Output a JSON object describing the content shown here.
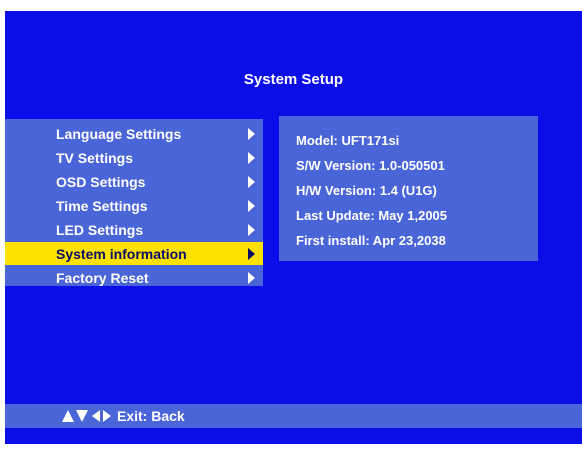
{
  "header": {
    "title": "System Setup"
  },
  "menu": {
    "items": [
      {
        "label": "Language Settings"
      },
      {
        "label": "TV Settings"
      },
      {
        "label": "OSD Settings"
      },
      {
        "label": "Time Settings"
      },
      {
        "label": "LED Settings"
      },
      {
        "label": "System information"
      },
      {
        "label": "Factory Reset"
      }
    ],
    "selected_label": "System information"
  },
  "info": {
    "model": "Model: UFT171si",
    "sw_version": "S/W Version: 1.0-050501",
    "hw_version": "H/W Version: 1.4 (U1G)",
    "last_update": "Last Update: May 1,2005",
    "first_install": "First install: Apr 23,2038"
  },
  "footer": {
    "nav_icons": [
      "up-arrow-icon",
      "down-arrow-icon",
      "left-arrow-icon",
      "right-arrow-icon"
    ],
    "hint": "Exit: Back"
  },
  "colors": {
    "background": "#0b0ee6",
    "panel": "#4a65d8",
    "highlight": "#fde200",
    "text": "#ffffff"
  }
}
